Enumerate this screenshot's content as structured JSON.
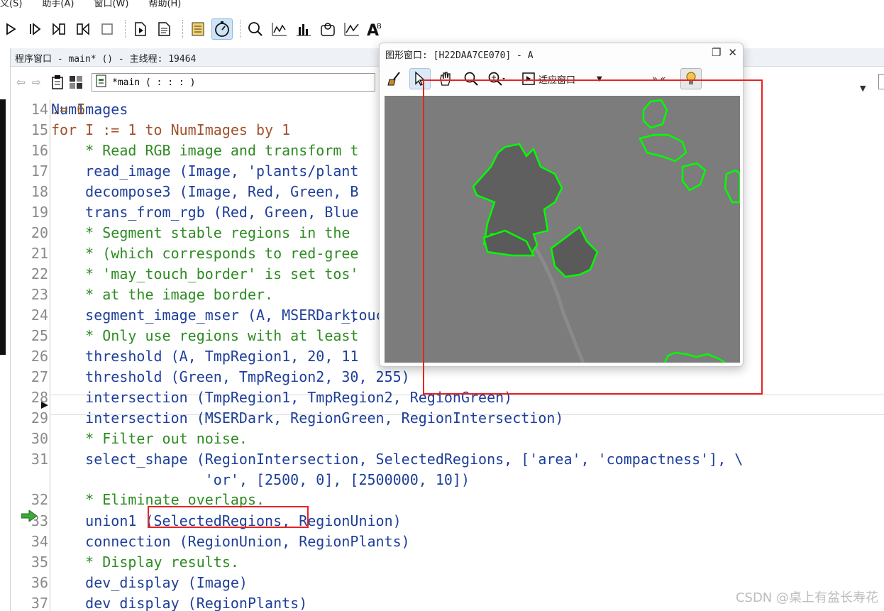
{
  "menu": [
    "义(S)",
    "助手(A)",
    "窗口(W)",
    "帮助(H)"
  ],
  "program_window": {
    "title": "程序窗口 - main* () - 主线程: 19464",
    "procedure": "*main ( : : : )"
  },
  "graphics_window": {
    "title": "图形窗口: [H22DAA7CE070] - A",
    "fit_label": "适应窗口",
    "more_label": "» «"
  },
  "code_lines": [
    {
      "n": "14",
      "tokens": [
        [
          "plain",
          "NumImages "
        ],
        [
          "op",
          ":= 6"
        ]
      ]
    },
    {
      "n": "15",
      "tokens": [
        [
          "kw",
          "for I := 1 to NumImages by 1"
        ]
      ]
    },
    {
      "n": "16",
      "tokens": [
        [
          "cm",
          "    * Read RGB image and transform t"
        ]
      ]
    },
    {
      "n": "17",
      "tokens": [
        [
          "fn",
          "    read_image (Image, 'plants/plant"
        ]
      ]
    },
    {
      "n": "18",
      "tokens": [
        [
          "fn",
          "    decompose3 (Image, Red, Green, B"
        ]
      ]
    },
    {
      "n": "19",
      "tokens": [
        [
          "fn",
          "    trans_from_rgb (Red, Green, Blue"
        ]
      ]
    },
    {
      "n": "20",
      "tokens": [
        [
          "cm",
          "    * Segment stable regions in the "
        ]
      ]
    },
    {
      "n": "21",
      "tokens": [
        [
          "cm",
          "    * (which corresponds to red-gree"
        ]
      ]
    },
    {
      "n": "22",
      "tokens": [
        [
          "cm",
          "    * 'may_touch_border' is set to '"
        ],
        [
          "cm",
          "                                  s"
        ]
      ]
    },
    {
      "n": "23",
      "tokens": [
        [
          "cm",
          "    * at the image border."
        ]
      ]
    },
    {
      "n": "24",
      "tokens": [
        [
          "fn",
          "    segment_image_mser (A, MSERDark,"
        ],
        [
          "fn",
          "                                  _touch_border',"
        ]
      ]
    },
    {
      "n": "25",
      "tokens": [
        [
          "cm",
          "    * Only use regions with at least"
        ]
      ]
    },
    {
      "n": "26",
      "tokens": [
        [
          "fn",
          "    threshold (A, TmpRegion1, 20, 11"
        ]
      ]
    },
    {
      "n": "27",
      "tokens": [
        [
          "fn",
          "    threshold (Green, TmpRegion2, 30, 255)"
        ]
      ]
    },
    {
      "n": "28",
      "tokens": [
        [
          "fn",
          "    intersection (TmpRegion1, TmpRegion2, RegionGreen)"
        ]
      ]
    },
    {
      "n": "29",
      "tokens": [
        [
          "fn",
          "    intersection (MSERDark, RegionGreen, RegionIntersection)"
        ]
      ]
    },
    {
      "n": "30",
      "tokens": [
        [
          "cm",
          "    * Filter out noise."
        ]
      ]
    },
    {
      "n": "31",
      "tokens": [
        [
          "fn",
          "    select_shape (RegionIntersection, SelectedRegions, ['area', 'compactness'], \\"
        ]
      ]
    },
    {
      "n": "",
      "tokens": [
        [
          "fn",
          "                  'or', [2500, 0], [2500000, 10])"
        ]
      ]
    },
    {
      "n": "32",
      "tokens": [
        [
          "cm",
          "    * Eliminate overlaps."
        ]
      ]
    },
    {
      "n": "33",
      "tokens": [
        [
          "fn",
          "    union1 (SelectedRegions, RegionUnion)"
        ]
      ]
    },
    {
      "n": "34",
      "tokens": [
        [
          "fn",
          "    connection (RegionUnion, RegionPlants)"
        ]
      ]
    },
    {
      "n": "35",
      "tokens": [
        [
          "cm",
          "    * Display results."
        ]
      ]
    },
    {
      "n": "36",
      "tokens": [
        [
          "fn",
          "    dev_display (Image)"
        ]
      ]
    },
    {
      "n": "37",
      "tokens": [
        [
          "fn",
          "    dev_display (RegionPlants)"
        ]
      ]
    }
  ],
  "watermark": "CSDN @桌上有盆长寿花",
  "colors": {
    "keyword": "#a0522d",
    "comment": "#2e8b22",
    "operator": "#1e3f9a",
    "region_overlay": "#00ff00",
    "annotation": "#ea2222"
  }
}
